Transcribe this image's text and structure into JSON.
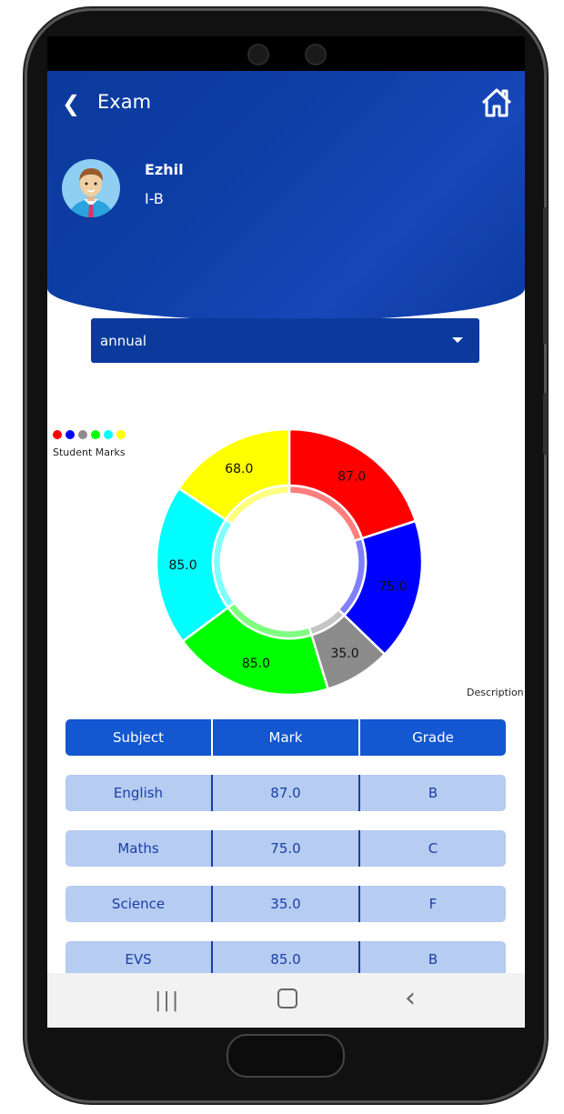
{
  "header": {
    "title": "Exam",
    "back_icon": "chevron-left-icon",
    "home_icon": "home-icon"
  },
  "student": {
    "name": "Ezhil",
    "class": "I-B"
  },
  "exam_select": {
    "value": "annual"
  },
  "chart_data": {
    "type": "pie",
    "donut": true,
    "legend_label": "Student Marks",
    "description": "Description",
    "values": [
      87.0,
      75.0,
      35.0,
      85.0,
      85.0,
      68.0
    ],
    "labels": [
      "87.0",
      "75.0",
      "35.0",
      "85.0",
      "85.0",
      "68.0"
    ],
    "colors": [
      "#ff0000",
      "#0000ff",
      "#8c8c8c",
      "#00ff00",
      "#00ffff",
      "#ffff00"
    ],
    "legend": "top-left"
  },
  "table": {
    "headers": [
      "Subject",
      "Mark",
      "Grade"
    ],
    "rows": [
      [
        "English",
        "87.0",
        "B"
      ],
      [
        "Maths",
        "75.0",
        "C"
      ],
      [
        "Science",
        "35.0",
        "F"
      ],
      [
        "EVS",
        "85.0",
        "B"
      ]
    ]
  },
  "navbar": {
    "recents": "|||",
    "home": "○",
    "back": "‹"
  }
}
